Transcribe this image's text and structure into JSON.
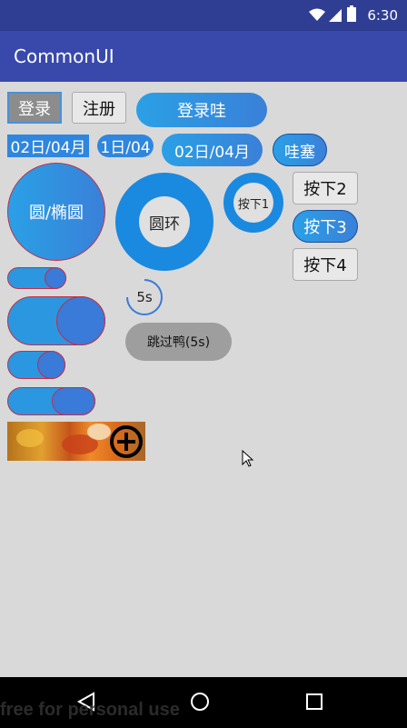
{
  "status_bar": {
    "time": "6:30"
  },
  "app_bar": {
    "title": "CommonUI"
  },
  "buttons": {
    "login": "登录",
    "register": "注册",
    "login_wa": "登录哇",
    "date1": "02日/04月",
    "date2": "1日/04",
    "date3": "02日/04月",
    "wasai": "哇塞",
    "circle_ellipse": "圆/椭圆",
    "ring": "圆环",
    "press1": "按下1",
    "press2": "按下2",
    "press3": "按下3",
    "press4": "按下4"
  },
  "countdown": {
    "label": "5s"
  },
  "skip_button": {
    "label": "跳过鸭(5s)"
  },
  "toggles": [
    {
      "state": "on"
    },
    {
      "state": "on"
    },
    {
      "state": "on"
    },
    {
      "state": "on"
    }
  ],
  "watermark": "free for personal use",
  "colors": {
    "status_bar": "#2f3d92",
    "app_bar": "#3949ab",
    "accent_blue": "#2f86df",
    "toggle_knob": "#3a7ad8",
    "toggle_border": "#c0304a",
    "gray_button": "#8c8c8c"
  }
}
